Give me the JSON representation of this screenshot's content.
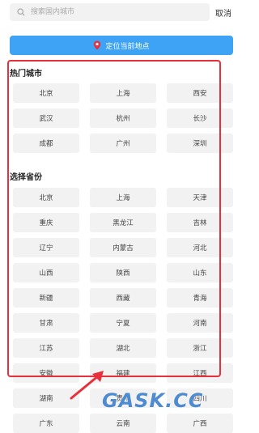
{
  "search": {
    "placeholder": "搜索国内城市",
    "cancel_label": "取消"
  },
  "locate": {
    "label": "定位当前地点"
  },
  "hot_cities": {
    "title": "热门城市",
    "items": [
      "北京",
      "上海",
      "西安",
      "武汉",
      "杭州",
      "长沙",
      "成都",
      "广州",
      "深圳"
    ]
  },
  "provinces": {
    "title": "选择省份",
    "items": [
      "北京",
      "上海",
      "天津",
      "重庆",
      "黑龙江",
      "吉林",
      "辽宁",
      "内蒙古",
      "河北",
      "山西",
      "陕西",
      "山东",
      "新疆",
      "西藏",
      "青海",
      "甘肃",
      "宁夏",
      "河南",
      "江苏",
      "湖北",
      "浙江",
      "安徽",
      "福建",
      "江西",
      "湖南",
      "贵州",
      "四川",
      "广东",
      "云南",
      "广西"
    ]
  },
  "watermark": "GASK.CC",
  "colors": {
    "accent": "#3ea3f4",
    "highlight": "#e8303c",
    "cell_bg": "#f2f2f2"
  }
}
